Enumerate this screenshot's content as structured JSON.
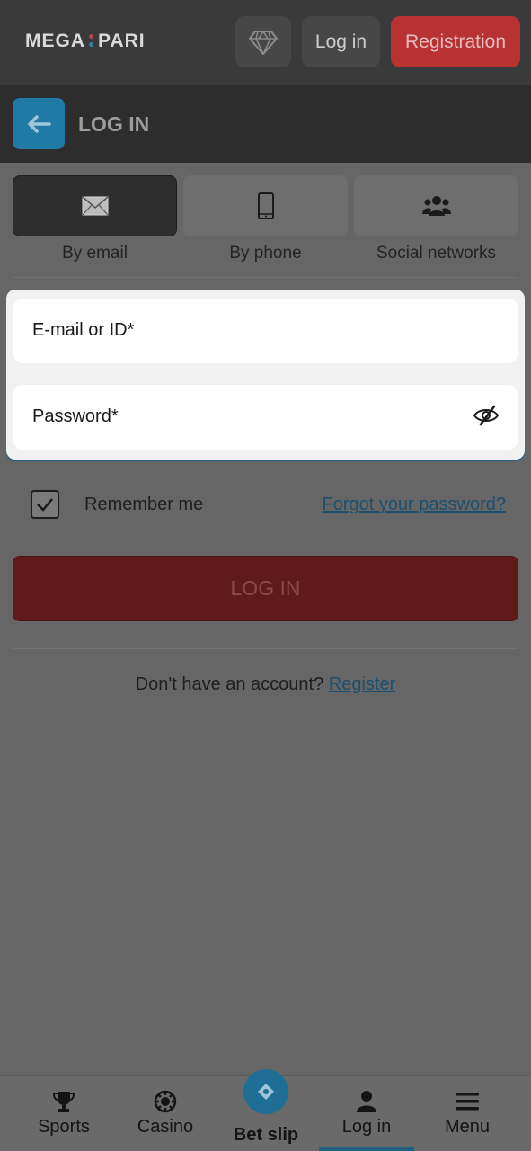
{
  "header": {
    "logo_left": "MEGA",
    "logo_right": "PARI",
    "login_label": "Log in",
    "register_label": "Registration",
    "diamond_icon": "diamond-icon"
  },
  "page": {
    "title": "LOG IN",
    "back_icon": "arrow-left-icon"
  },
  "tabs": [
    {
      "label": "By email",
      "icon": "envelope-icon",
      "active": true
    },
    {
      "label": "By phone",
      "icon": "phone-icon",
      "active": false
    },
    {
      "label": "Social networks",
      "icon": "users-icon",
      "active": false
    }
  ],
  "form": {
    "email_placeholder": "E-mail or ID*",
    "password_placeholder": "Password*",
    "remember_label": "Remember me",
    "remember_checked": true,
    "forgot_label": "Forgot your password?",
    "submit_label": "LOG IN",
    "no_account_text": "Don't have an account?",
    "register_link": "Register"
  },
  "bottom_nav": [
    {
      "label": "Sports",
      "icon": "trophy-icon"
    },
    {
      "label": "Casino",
      "icon": "casino-chip-icon"
    },
    {
      "label": "Bet slip",
      "icon": "ticket-icon"
    },
    {
      "label": "Log in",
      "icon": "user-icon",
      "active": true
    },
    {
      "label": "Menu",
      "icon": "hamburger-icon"
    }
  ],
  "colors": {
    "accent_blue": "#1f7aa6",
    "brand_red": "#b83232"
  }
}
